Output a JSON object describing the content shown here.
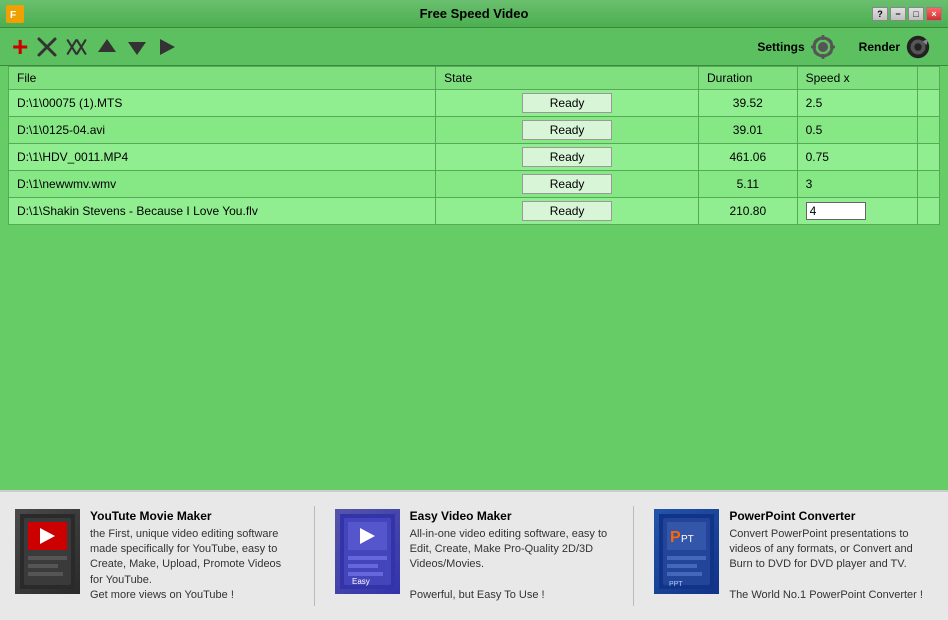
{
  "window": {
    "title": "Free Speed Video",
    "controls": [
      "?",
      "-",
      "□",
      "×"
    ]
  },
  "toolbar": {
    "add_label": "+",
    "settings_label": "Settings",
    "render_label": "Render"
  },
  "table": {
    "columns": [
      "File",
      "State",
      "Duration",
      "Speed x"
    ],
    "rows": [
      {
        "file": "D:\\1\\00075 (1).MTS",
        "state": "Ready",
        "duration": "39.52",
        "speed": "2.5",
        "editing": false
      },
      {
        "file": "D:\\1\\0125-04.avi",
        "state": "Ready",
        "duration": "39.01",
        "speed": "0.5",
        "editing": false
      },
      {
        "file": "D:\\1\\HDV_0011.MP4",
        "state": "Ready",
        "duration": "461.06",
        "speed": "0.75",
        "editing": false
      },
      {
        "file": "D:\\1\\newwmv.wmv",
        "state": "Ready",
        "duration": "5.11",
        "speed": "3",
        "editing": false
      },
      {
        "file": "D:\\1\\Shakin Stevens - Because I Love You.flv",
        "state": "Ready",
        "duration": "210.80",
        "speed": "4|",
        "editing": true
      }
    ]
  },
  "ads": [
    {
      "id": "youtube-movie-maker",
      "title": "YouTute Movie Maker",
      "desc": "the First, unique video editing software made specifically for YouTube, easy to Create, Make, Upload, Promote Videos for YouTube.\nGet more views on YouTube !"
    },
    {
      "id": "easy-video-maker",
      "title": "Easy Video Maker",
      "desc": "All-in-one video editing software, easy to Edit, Create, Make Pro-Quality 2D/3D Videos/Movies.\n\nPowerful, but Easy To Use !"
    },
    {
      "id": "powerpoint-converter",
      "title": "PowerPoint Converter",
      "desc": "Convert PowerPoint presentations to videos of any formats, or Convert and Burn to DVD for DVD player and TV.\n\nThe World No.1 PowerPoint Converter !"
    }
  ]
}
